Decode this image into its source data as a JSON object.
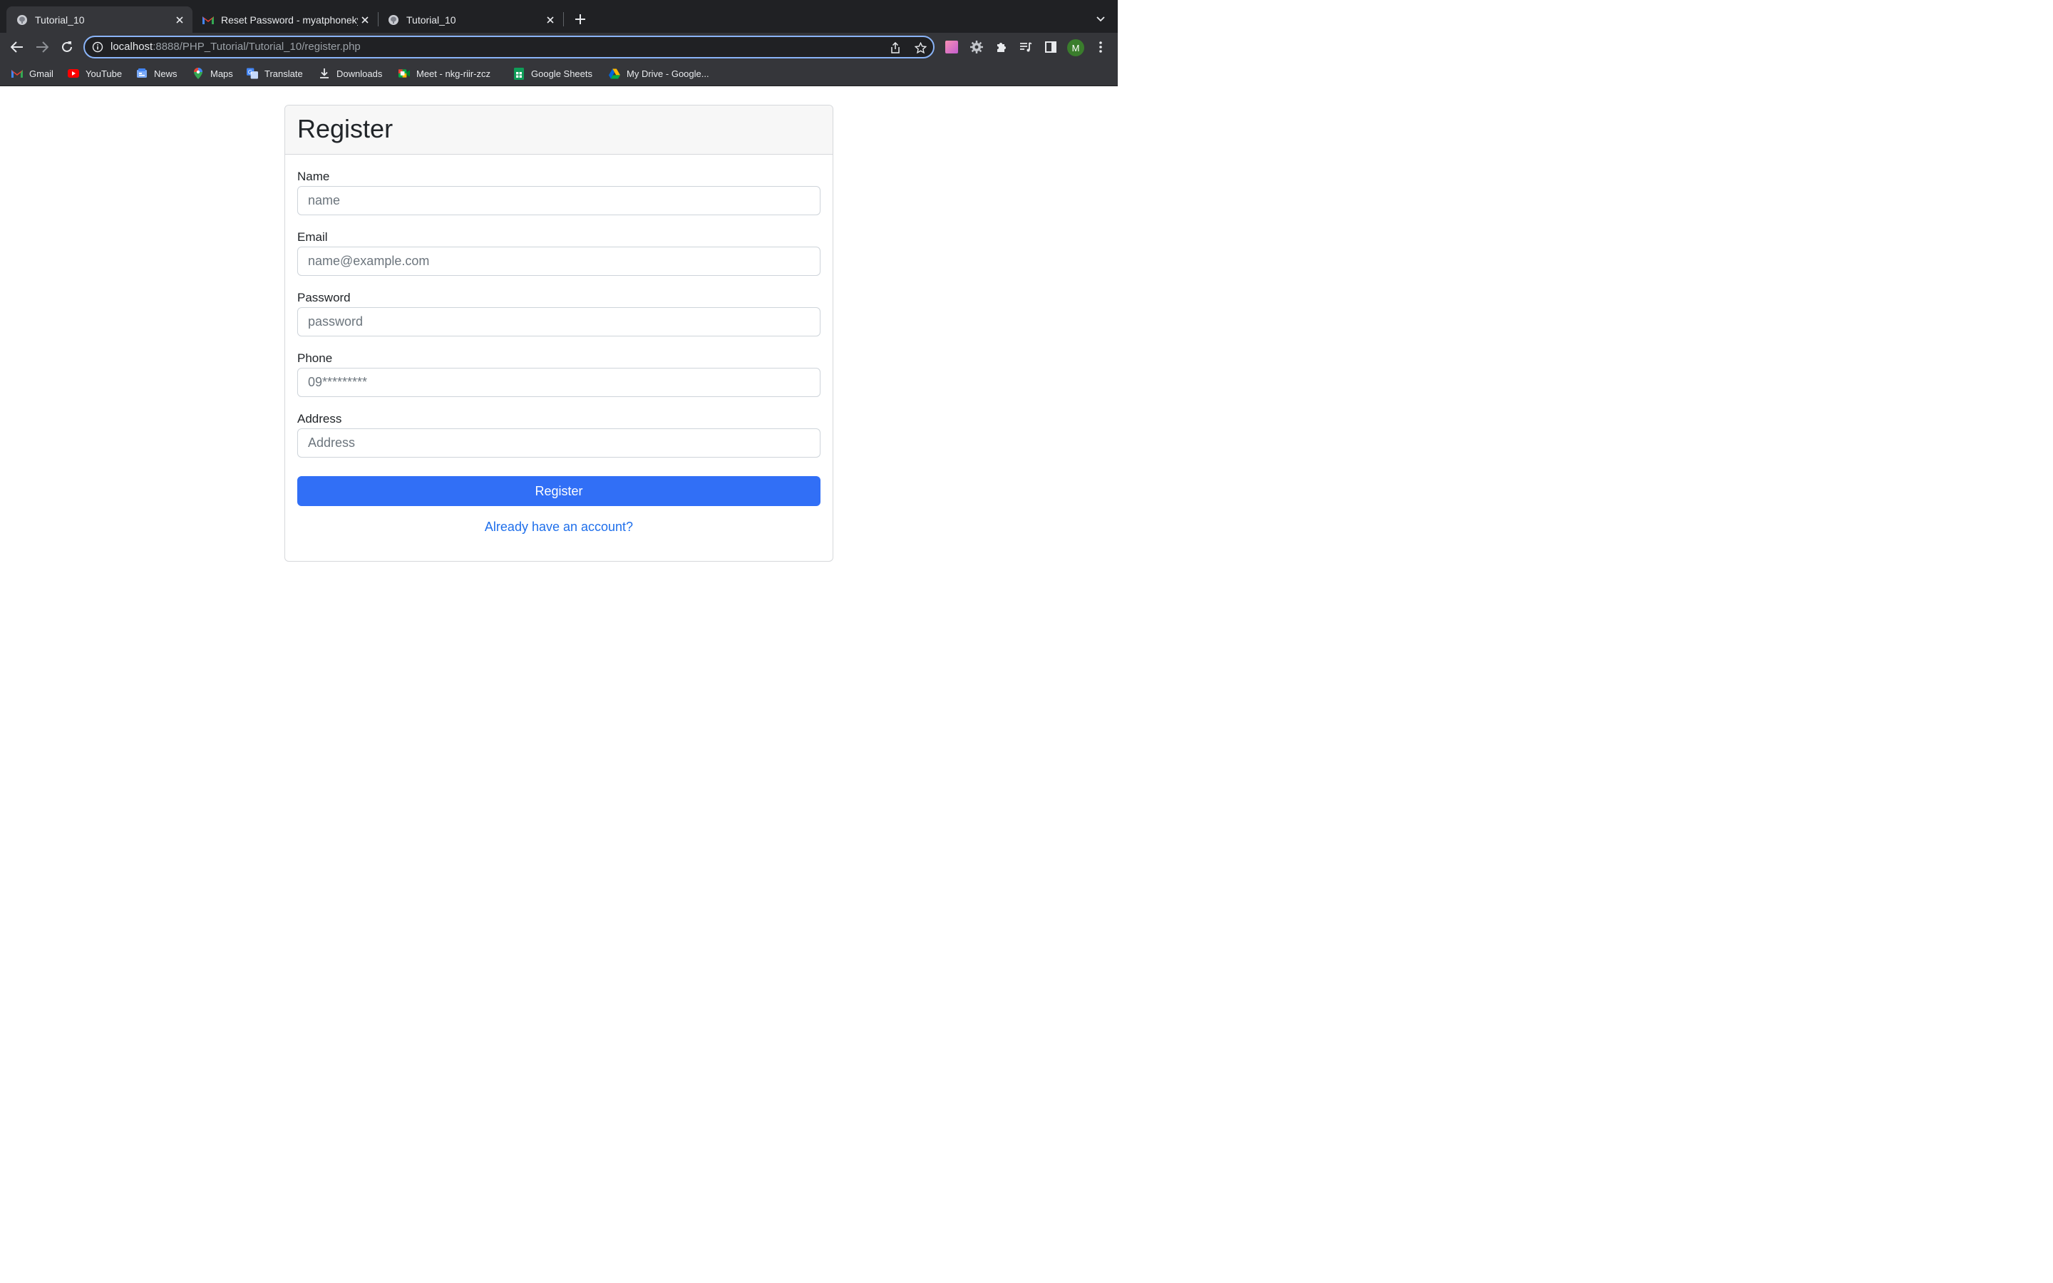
{
  "browser": {
    "tabs": [
      {
        "title": "Tutorial_10",
        "active": true,
        "icon": "elephant-favicon"
      },
      {
        "title": "Reset Password - myatphonekyaw",
        "active": false,
        "icon": "gmail-favicon"
      },
      {
        "title": "Tutorial_10",
        "active": false,
        "icon": "elephant-favicon"
      }
    ],
    "address": {
      "host": "localhost",
      "rest": ":8888/PHP_Tutorial/Tutorial_10/register.php"
    },
    "profile_initial": "M",
    "bookmarks": [
      {
        "label": "Gmail",
        "icon": "gmail-icon"
      },
      {
        "label": "YouTube",
        "icon": "youtube-icon"
      },
      {
        "label": "News",
        "icon": "news-icon"
      },
      {
        "label": "Maps",
        "icon": "maps-icon"
      },
      {
        "label": "Translate",
        "icon": "translate-icon"
      },
      {
        "label": "Downloads",
        "icon": "download-icon"
      },
      {
        "label": "Meet - nkg-riir-zcz",
        "icon": "meet-icon"
      },
      {
        "label": "Google Sheets",
        "icon": "sheets-icon"
      },
      {
        "label": "My Drive - Google...",
        "icon": "drive-icon"
      }
    ]
  },
  "form": {
    "title": "Register",
    "fields": [
      {
        "label": "Name",
        "placeholder": "name"
      },
      {
        "label": "Email",
        "placeholder": "name@example.com"
      },
      {
        "label": "Password",
        "placeholder": "password"
      },
      {
        "label": "Phone",
        "placeholder": "09*********"
      },
      {
        "label": "Address",
        "placeholder": "Address"
      }
    ],
    "submit_label": "Register",
    "login_link": "Already have an account?"
  },
  "colors": {
    "primary": "#316ff6",
    "link": "#1f6feb",
    "omnibox_focus": "#8ab4f8"
  }
}
